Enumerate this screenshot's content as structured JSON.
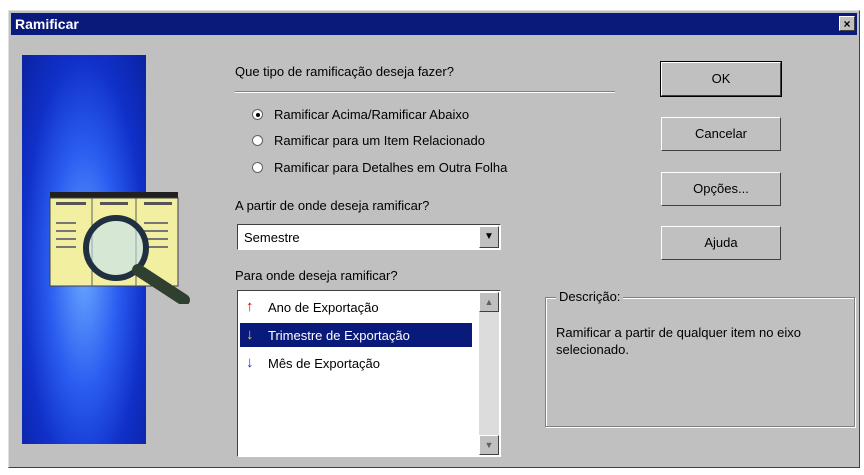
{
  "window": {
    "title": "Ramificar",
    "close_label": "×"
  },
  "branch_type": {
    "question": "Que tipo de ramificação deseja fazer?",
    "options": [
      {
        "label": "Ramificar Acima/Ramificar Abaixo",
        "selected": true
      },
      {
        "label": "Ramificar para um Item Relacionado",
        "selected": false
      },
      {
        "label": "Ramificar para Detalhes em Outra Folha",
        "selected": false
      }
    ]
  },
  "from_where": {
    "question": "A partir de onde deseja ramificar?",
    "value": "Semestre"
  },
  "to_where": {
    "question": "Para onde deseja ramificar?",
    "items": [
      {
        "icon": "red-up-arrow-icon",
        "glyph": "↑",
        "color": "#e00000",
        "label": "Ano de Exportação",
        "selected": false
      },
      {
        "icon": "yellow-down-arrow-icon",
        "glyph": "↓",
        "color": "#f0d000",
        "label": "Trimestre de Exportação",
        "selected": true
      },
      {
        "icon": "blue-down-arrow-icon",
        "glyph": "↓",
        "color": "#1030d0",
        "label": "Mês de Exportação",
        "selected": false
      }
    ]
  },
  "buttons": {
    "ok": "OK",
    "cancel": "Cancelar",
    "options": "Opções...",
    "help": "Ajuda"
  },
  "description": {
    "title": "Descrição:",
    "text": "Ramificar a partir de qualquer item no eixo selecionado."
  },
  "colors": {
    "titlebar": "#0a1a7a",
    "selection": "#0a1a7a",
    "face": "#c0c0c0"
  }
}
